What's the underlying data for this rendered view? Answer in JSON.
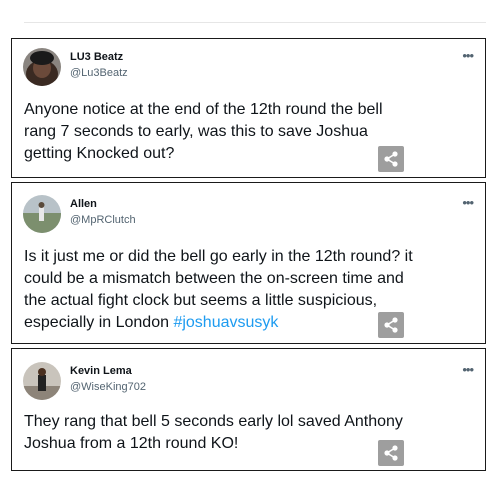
{
  "tweets": [
    {
      "name": "LU3 Beatz",
      "handle": "@Lu3Beatz",
      "body_lines": [
        "Anyone notice at the end of the 12th round the bell",
        "rang 7 seconds to early, was this to save Joshua",
        "getting Knocked out?"
      ]
    },
    {
      "name": "Allen",
      "handle": "@MpRClutch",
      "body_lines": [
        "Is it just me or did the bell go early in the 12th round? it",
        "could be a mismatch between the on-screen time and",
        "the actual fight clock but seems a little suspicious,"
      ],
      "body_last_prefix": "especially in London ",
      "hashtag": "#joshuavsusyk"
    },
    {
      "name": "Kevin Lema",
      "handle": "@WiseKing702",
      "body_lines": [
        "They rang that bell 5 seconds early lol saved Anthony",
        "Joshua from a 12th round KO!"
      ]
    }
  ],
  "more_symbol": "•••",
  "icons": {
    "more": "more-options-icon",
    "share": "share-icon"
  },
  "colors": {
    "hashtag": "#1d9bf0",
    "handle": "#536471",
    "share_bg": "#9e9e9e"
  }
}
